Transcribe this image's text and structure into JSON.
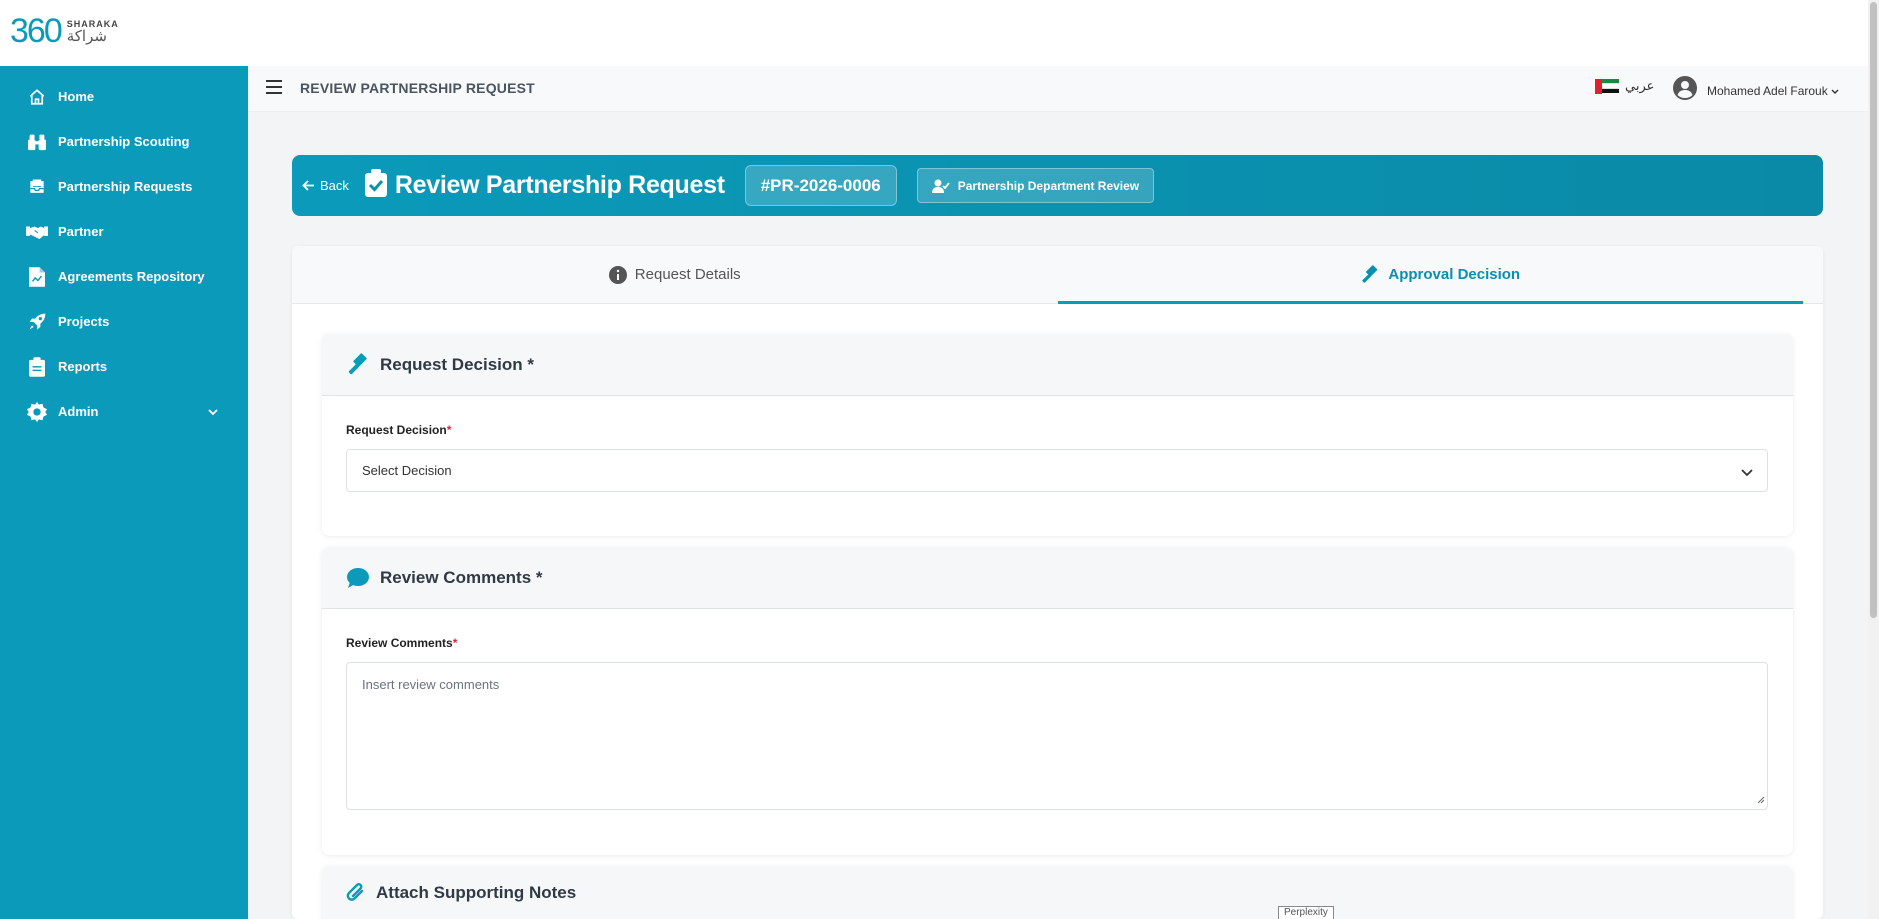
{
  "logo": {
    "number": "360",
    "name_en": "SHARAKA",
    "name_ar": "شراكة"
  },
  "sidebar": {
    "items": [
      {
        "label": "Home",
        "icon": "home-icon"
      },
      {
        "label": "Partnership Scouting",
        "icon": "binoculars-icon"
      },
      {
        "label": "Partnership Requests",
        "icon": "inbox-icon"
      },
      {
        "label": "Partner",
        "icon": "handshake-icon"
      },
      {
        "label": "Agreements Repository",
        "icon": "document-icon"
      },
      {
        "label": "Projects",
        "icon": "rocket-icon"
      },
      {
        "label": "Reports",
        "icon": "clipboard-icon"
      },
      {
        "label": "Admin",
        "icon": "gear-icon"
      }
    ]
  },
  "header": {
    "title": "REVIEW PARTNERSHIP REQUEST",
    "language_label": "عربي",
    "user_name": "Mohamed Adel Farouk"
  },
  "hero": {
    "back_label": "Back",
    "title": "Review Partnership Request",
    "request_id": "#PR-2026-0006",
    "stage": "Partnership Department Review"
  },
  "tabs": [
    {
      "label": "Request Details",
      "active": false
    },
    {
      "label": "Approval Decision",
      "active": true
    }
  ],
  "decision_section": {
    "title": "Request Decision *",
    "field_label": "Request Decision",
    "required_mark": "*",
    "select_value": "Select Decision"
  },
  "comments_section": {
    "title": "Review Comments *",
    "field_label": "Review Comments",
    "required_mark": "*",
    "placeholder": "Insert review comments"
  },
  "attach_section": {
    "title": "Attach Supporting Notes"
  },
  "tooltip": "Perplexity",
  "colors": {
    "primary": "#0b9aba",
    "required": "#d6283a"
  }
}
